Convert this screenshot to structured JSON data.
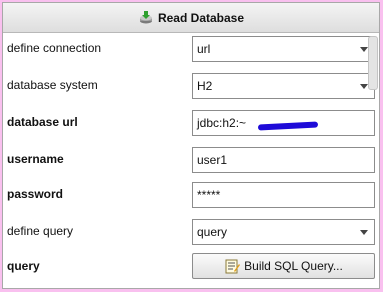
{
  "header": {
    "title": "Read Database",
    "icon": "database-download-icon"
  },
  "rows": [
    {
      "label": "define connection",
      "type": "select",
      "value": "url"
    },
    {
      "label": "database system",
      "type": "select",
      "value": "H2"
    },
    {
      "label": "database url",
      "type": "text",
      "value": "jdbc:h2:~"
    },
    {
      "label": "username",
      "type": "text",
      "value": "user1"
    },
    {
      "label": "password",
      "type": "password",
      "value": "*****"
    },
    {
      "label": "define query",
      "type": "select",
      "value": "query"
    },
    {
      "label": "query",
      "type": "button",
      "value": "Build SQL Query..."
    }
  ],
  "colors": {
    "background": "#f9c0ef",
    "panel": "#ffffff",
    "redaction": "#1e0bd8"
  }
}
